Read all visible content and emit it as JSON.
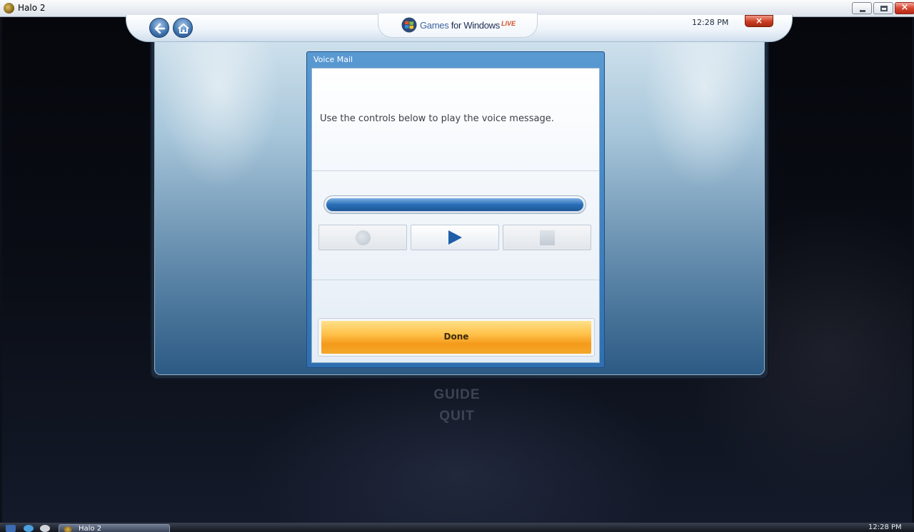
{
  "window": {
    "title": "Halo 2",
    "controls": {
      "minimize": "minimize",
      "maximize": "maximize",
      "close": "close"
    }
  },
  "game_menu": {
    "items": [
      "GUIDE",
      "QUIT"
    ]
  },
  "guide": {
    "brand": {
      "games": "Games",
      "for_windows": "for Windows",
      "live": "LIVE"
    },
    "clock": "12:28 PM",
    "close_label": "×",
    "nav": {
      "back_icon": "back-arrow-icon",
      "home_icon": "home-icon"
    }
  },
  "dialog": {
    "title": "Voice Mail",
    "instruction": "Use the controls below to play the voice message.",
    "playback_progress": 1.0,
    "controls": [
      {
        "name": "record",
        "icon": "record-icon",
        "enabled": false
      },
      {
        "name": "play",
        "icon": "play-icon",
        "enabled": true
      },
      {
        "name": "stop",
        "icon": "stop-icon",
        "enabled": false
      }
    ],
    "done_label": "Done"
  },
  "taskbar": {
    "task_label": "Halo 2",
    "clock": "12:28 PM"
  },
  "colors": {
    "accent_blue": "#2a6eb6",
    "done_orange": "#f59a1a",
    "close_red": "#cc3c22"
  }
}
